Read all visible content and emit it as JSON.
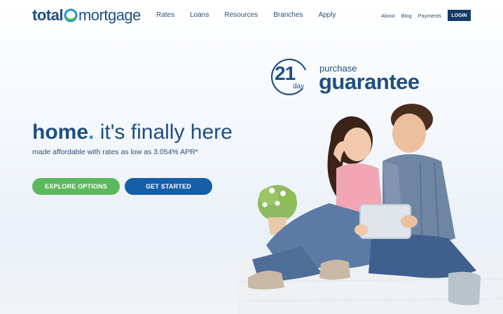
{
  "logo": {
    "part1": "total",
    "part2": "mortgage"
  },
  "nav": [
    {
      "label": "Rates"
    },
    {
      "label": "Loans"
    },
    {
      "label": "Resources"
    },
    {
      "label": "Branches"
    },
    {
      "label": "Apply"
    }
  ],
  "util_links": [
    {
      "label": "About"
    },
    {
      "label": "Blog"
    },
    {
      "label": "Payments"
    }
  ],
  "login_label": "LOGIN",
  "badge": {
    "number": "21",
    "day": "day",
    "purchase": "purchase",
    "guarantee": "guarantee"
  },
  "hero": {
    "title_highlight": "home",
    "title_dot": ".",
    "title_rest": " it's finally here",
    "subtitle": "made affordable with rates as low as 3.054% APR*"
  },
  "buttons": {
    "explore": "EXPLORE OPTIONS",
    "start": "GET STARTED"
  },
  "colors": {
    "brand": "#1f4f82",
    "accent": "#1f8fd6",
    "green": "#5cb85c",
    "blue": "#155ea8",
    "login": "#143b66"
  },
  "icons": {
    "logo_mark": "swirl-o-icon"
  }
}
